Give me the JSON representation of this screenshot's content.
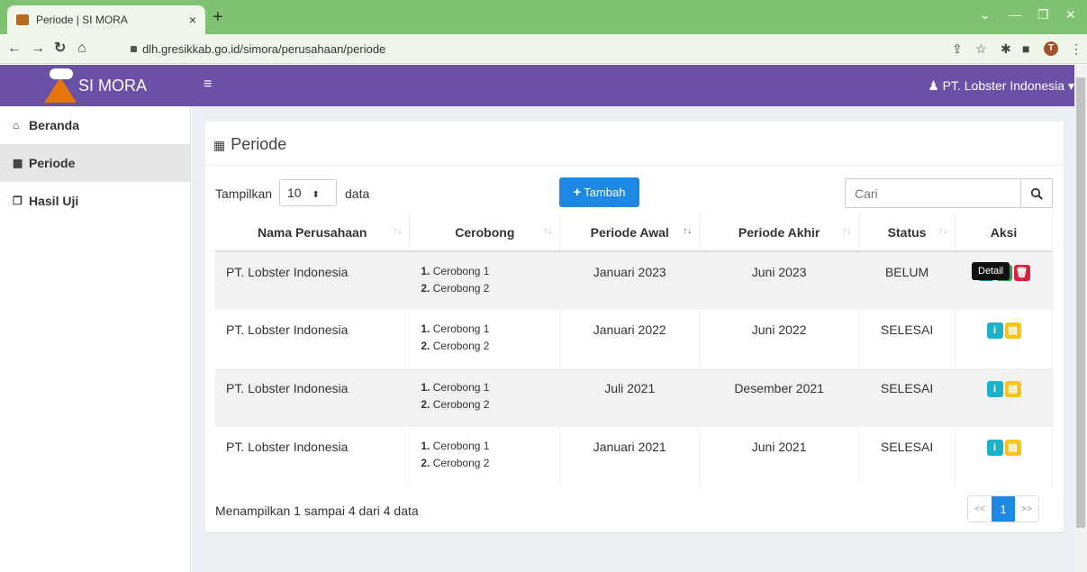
{
  "browser": {
    "tab_title": "Periode | SI MORA",
    "tab_close": "×",
    "new_tab": "+",
    "url": "dlh.gresikkab.go.id/simora/perusahaan/periode",
    "profile_initial": "T"
  },
  "header": {
    "brand": "SI MORA",
    "menu_toggle": "≡",
    "user": "PT. Lobster Indonesia"
  },
  "sidebar": {
    "items": [
      {
        "label": "Beranda",
        "icon": "home-icon",
        "active": false
      },
      {
        "label": "Periode",
        "icon": "calendar-icon",
        "active": true
      },
      {
        "label": "Hasil Uji",
        "icon": "files-icon",
        "active": false
      }
    ]
  },
  "main": {
    "title": "Periode",
    "length_prefix": "Tampilkan",
    "length_value": "10",
    "length_suffix": "data",
    "add_button": "Tambah",
    "search_placeholder": "Cari",
    "columns": [
      "Nama Perusahaan",
      "Cerobong",
      "Periode Awal",
      "Periode Akhir",
      "Status",
      "Aksi"
    ],
    "rows": [
      {
        "nama": "PT. Lobster Indonesia",
        "cerobong": [
          "Cerobong 1",
          "Cerobong 2"
        ],
        "awal": "Januari 2023",
        "akhir": "Juni 2023",
        "status": "BELUM"
      },
      {
        "nama": "PT. Lobster Indonesia",
        "cerobong": [
          "Cerobong 1",
          "Cerobong 2"
        ],
        "awal": "Januari 2022",
        "akhir": "Juni 2022",
        "status": "SELESAI"
      },
      {
        "nama": "PT. Lobster Indonesia",
        "cerobong": [
          "Cerobong 1",
          "Cerobong 2"
        ],
        "awal": "Juli 2021",
        "akhir": "Desember 2021",
        "status": "SELESAI"
      },
      {
        "nama": "PT. Lobster Indonesia",
        "cerobong": [
          "Cerobong 1",
          "Cerobong 2"
        ],
        "awal": "Januari 2021",
        "akhir": "Juni 2021",
        "status": "SELESAI"
      }
    ],
    "tooltip": "Detail",
    "info": "Menampilkan 1 sampai 4 dari 4 data",
    "pager": {
      "prev": "<<",
      "current": "1",
      "next": ">>"
    }
  },
  "colors": {
    "header": "#6a51a7",
    "primary": "#1e88e5",
    "info": "#1cb3c8",
    "success": "#22a847",
    "danger": "#d9233e",
    "warning": "#f5c518"
  }
}
